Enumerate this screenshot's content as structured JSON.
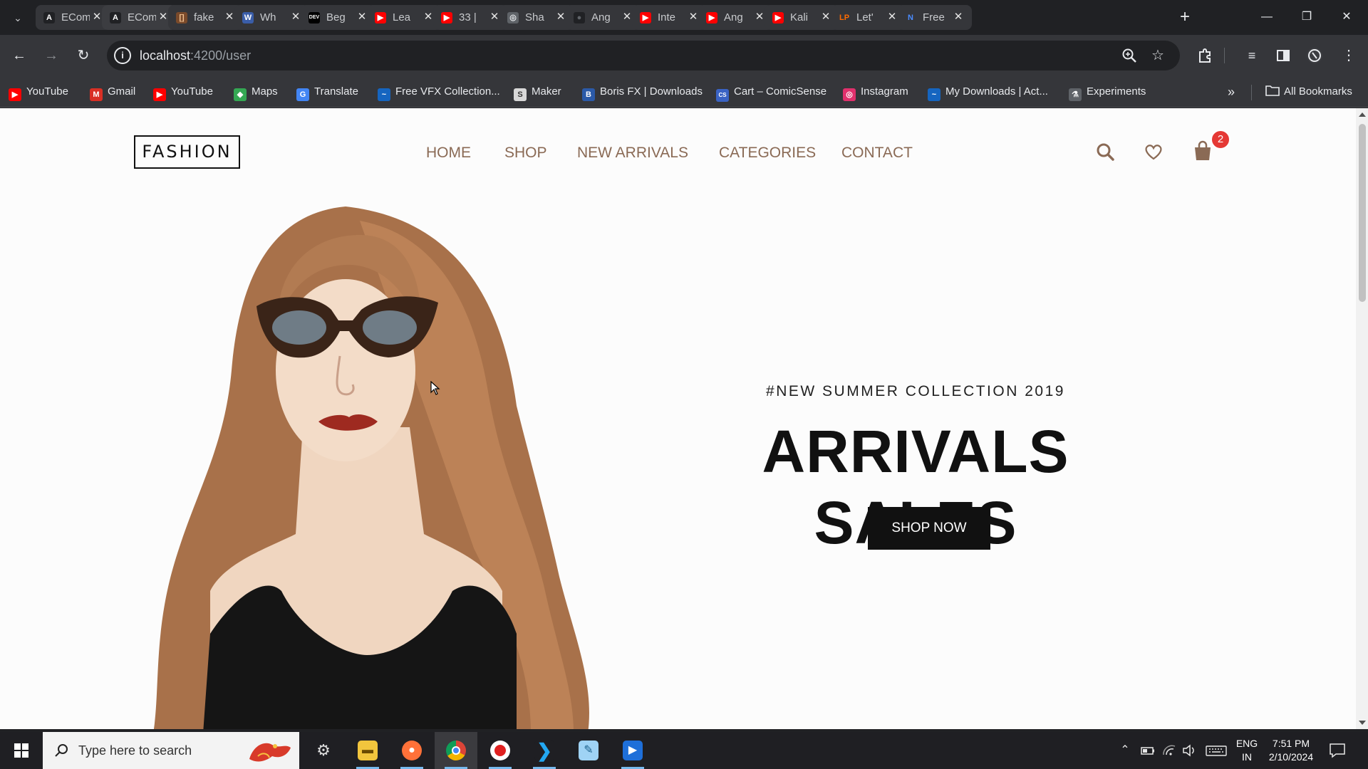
{
  "browser": {
    "tabs": [
      {
        "label": "ECom",
        "favicon": "A",
        "favicon_bg": "#202124",
        "favicon_color": "#ffffff",
        "active": false
      },
      {
        "label": "ECom",
        "favicon": "A",
        "favicon_bg": "#202124",
        "favicon_color": "#ffffff",
        "active": true
      },
      {
        "label": "fake",
        "favicon": "[]",
        "favicon_bg": "#7a4a2a",
        "favicon_color": "#f0c090",
        "active": false
      },
      {
        "label": "Wh",
        "favicon": "W",
        "favicon_bg": "#3a5da8",
        "favicon_color": "#ffffff",
        "active": false
      },
      {
        "label": "Beg",
        "favicon": "DEV",
        "favicon_bg": "#000000",
        "favicon_color": "#ffffff",
        "active": false
      },
      {
        "label": "Lea",
        "favicon": "▶",
        "favicon_bg": "#ff0000",
        "favicon_color": "#ffffff",
        "active": false
      },
      {
        "label": "33 |",
        "favicon": "▶",
        "favicon_bg": "#ff0000",
        "favicon_color": "#ffffff",
        "active": false
      },
      {
        "label": "Sha",
        "favicon": "◎",
        "favicon_bg": "#5f6368",
        "favicon_color": "#e8eaed",
        "active": false
      },
      {
        "label": "Ang",
        "favicon": "●",
        "favicon_bg": "#202124",
        "favicon_color": "#5f6368",
        "active": false
      },
      {
        "label": "Inte",
        "favicon": "▶",
        "favicon_bg": "#ff0000",
        "favicon_color": "#ffffff",
        "active": false
      },
      {
        "label": "Ang",
        "favicon": "▶",
        "favicon_bg": "#ff0000",
        "favicon_color": "#ffffff",
        "active": false
      },
      {
        "label": "Kali",
        "favicon": "▶",
        "favicon_bg": "#ff0000",
        "favicon_color": "#ffffff",
        "active": false
      },
      {
        "label": "Let'",
        "favicon": "LP",
        "favicon_bg": "#35363a",
        "favicon_color": "#ff6a00",
        "active": false
      },
      {
        "label": "Free",
        "favicon": "N",
        "favicon_bg": "#35363a",
        "favicon_color": "#4a8cff",
        "active": false
      }
    ],
    "tab_close": "✕",
    "new_tab": "+",
    "window_controls": {
      "minimize": "—",
      "restore": "❐",
      "close": "✕"
    },
    "url_host": "localhost",
    "url_path": ":4200/user",
    "site_info_icon": "i",
    "bookmarks": [
      {
        "label": "YouTube",
        "icon": "▶",
        "icon_bg": "#ff0000"
      },
      {
        "label": "Gmail",
        "icon": "M",
        "icon_bg": "#d93025"
      },
      {
        "label": "YouTube",
        "icon": "▶",
        "icon_bg": "#ff0000"
      },
      {
        "label": "Maps",
        "icon": "◆",
        "icon_bg": "#34a853"
      },
      {
        "label": "Translate",
        "icon": "G",
        "icon_bg": "#4285f4"
      },
      {
        "label": "Free VFX Collection...",
        "icon": "~",
        "icon_bg": "#1565c0"
      },
      {
        "label": "Maker",
        "icon": "S",
        "icon_bg": "#d8d8d8"
      },
      {
        "label": "Boris FX | Downloads",
        "icon": "B",
        "icon_bg": "#2b5aa8"
      },
      {
        "label": "Cart – ComicSense",
        "icon": "CS",
        "icon_bg": "#3a63c4"
      },
      {
        "label": "Instagram",
        "icon": "◎",
        "icon_bg": "#e1306c"
      },
      {
        "label": "My Downloads | Act...",
        "icon": "~",
        "icon_bg": "#1565c0"
      },
      {
        "label": "Experiments",
        "icon": "⚗",
        "icon_bg": "#5f6368"
      }
    ],
    "bookmarks_more": "»",
    "all_bookmarks": "All Bookmarks"
  },
  "site": {
    "logo": "FASHION",
    "nav": [
      "HOME",
      "SHOP",
      "NEW ARRIVALS",
      "CATEGORIES",
      "CONTACT"
    ],
    "cart_count": "2",
    "hero": {
      "subtitle": "#NEW SUMMER COLLECTION 2019",
      "title": "ARRIVALS SALES",
      "cta": "SHOP NOW"
    }
  },
  "taskbar": {
    "search_placeholder": "Type here to search",
    "language_top": "ENG",
    "language_bottom": "IN",
    "time": "7:51 PM",
    "date": "2/10/2024"
  },
  "colors": {
    "nav_link": "#8a6a55",
    "cart_badge": "#e53935",
    "cta_bg": "#111111"
  }
}
